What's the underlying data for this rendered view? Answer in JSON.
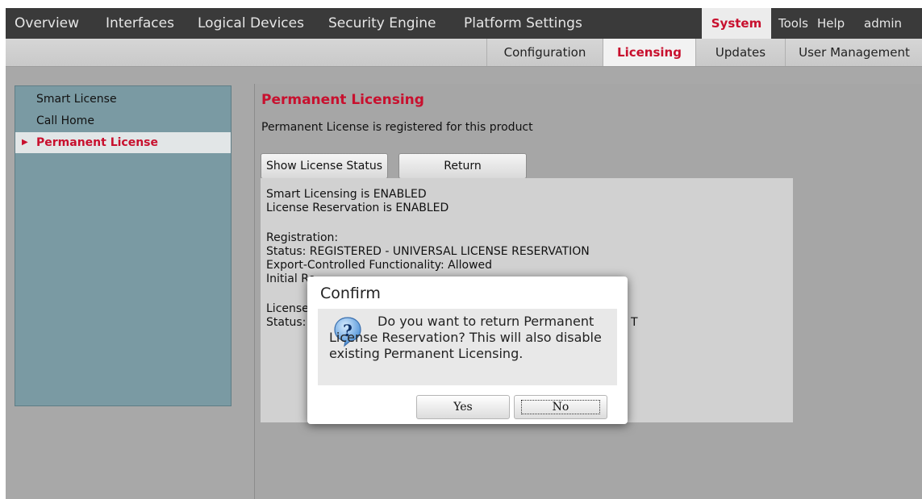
{
  "topnav": {
    "items": [
      "Overview",
      "Interfaces",
      "Logical Devices",
      "Security Engine",
      "Platform Settings"
    ],
    "system": "System",
    "tools": "Tools",
    "help": "Help",
    "user": "admin"
  },
  "subnav": {
    "tabs": [
      "Configuration",
      "Licensing",
      "Updates",
      "User Management"
    ],
    "active": "Licensing"
  },
  "sidebar": {
    "items": [
      "Smart License",
      "Call Home",
      "Permanent License"
    ],
    "active": "Permanent License"
  },
  "main": {
    "title": "Permanent Licensing",
    "subtitle": "Permanent License is registered for this product",
    "buttons": {
      "show_status": "Show License Status",
      "return": "Return"
    },
    "status_lines": [
      "Smart Licensing is ENABLED",
      "License Reservation is ENABLED",
      "Registration:",
      "Status: REGISTERED - UNIVERSAL LICENSE RESERVATION",
      "Export-Controlled Functionality: Allowed",
      "Initial Re",
      "License A",
      "Status: A",
      "T"
    ]
  },
  "dialog": {
    "title": "Confirm",
    "icon": "question-icon",
    "message": "Do you want to return Permanent License Reservation? This will also disable existing Permanent Licensing.",
    "yes": "Yes",
    "no": "No"
  },
  "colors": {
    "accent": "#c8102e",
    "topnav_bg": "#3a3a3a",
    "sidebar_bg": "#7a9aa3"
  }
}
